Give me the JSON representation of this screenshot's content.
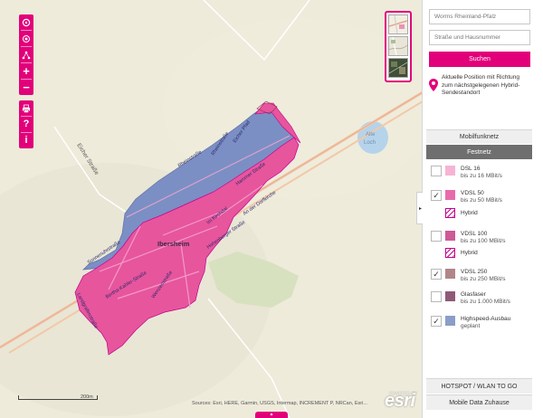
{
  "map": {
    "place_label": "Ibersheim",
    "lake_label_1": "Alte",
    "lake_label_2": "Loch",
    "streets": {
      "eicher": "Eicher Straße",
      "hamm": "Hammer Straße",
      "eicher_pfad": "Eicher Pfad",
      "rheinstrasse": "Rheinstraße",
      "im_kirchdal": "Im Kirchdal",
      "hohenberger": "Hohenberger Straße",
      "an_der_kirche": "An der Dorfkirche",
      "sonnenuhr": "Sonnenuhrstraße",
      "bertha": "Bertha-Kahler-Straße",
      "wenzen": "Wenzenstraße",
      "landgraf": "Landgrafenstraße",
      "nord": "Rheinaustraße"
    },
    "scale_label": "200m",
    "attribution": "Sources: Esri, HERE, Garmin, USGS, Intermap, INCREMENT P, NRCan, Esri...",
    "esri_logo": "esri",
    "esri_powered": "POWERED BY",
    "handle_glyph": "▲"
  },
  "toolbar": {
    "locate_icon": "target-icon",
    "gps_icon": "crosshair-icon",
    "share_icon": "share-icon",
    "zoom_in": "+",
    "zoom_out": "−",
    "print_icon": "print-icon",
    "help": "?",
    "info": "i"
  },
  "panel": {
    "search_placeholder": "Worms Rheinland-Pfalz",
    "street_placeholder": "Straße und Hausnummer",
    "search_button": "Suchen",
    "legend_text": "Aktuelle Position mit Richtung zum nächstgelegenen Hybrid-Sendestandort",
    "tabs": {
      "mobile": "Mobilfunknetz",
      "fixed": "Festnetz"
    },
    "collapse_glyph": "▸",
    "legend": [
      {
        "label": "DSL 16",
        "sub": "bis zu 16 MBit/s",
        "color": "#f6b4d4",
        "checked": false
      },
      {
        "label": "VDSL 50",
        "sub": "bis zu 50 MBit/s",
        "color": "#e86aac",
        "checked": true,
        "hybrid": "Hybrid"
      },
      {
        "label": "VDSL 100",
        "sub": "bis zu 100 MBit/s",
        "color": "#cc5b96",
        "checked": false,
        "hybrid": "Hybrid"
      },
      {
        "label": "VDSL 250",
        "sub": "bis zu 250 MBit/s",
        "color": "#b0868a",
        "checked": true
      },
      {
        "label": "Glasfaser",
        "sub": "bis zu 1.000 MBit/s",
        "color": "#8f5a77",
        "checked": false
      },
      {
        "label": "Highspeed-Ausbau",
        "sub": "geplant",
        "color": "#8a9ec6",
        "checked": true
      }
    ],
    "check_glyph": "✓",
    "bottom_tabs": {
      "hotspot": "HOTSPOT / WLAN TO GO",
      "mobile_data": "Mobile Data Zuhause"
    }
  },
  "colors": {
    "accent": "#e2007a",
    "vdsl_area": "#e7559d",
    "planned_area": "#7b8fc4",
    "map_bg": "#eeebdb"
  }
}
